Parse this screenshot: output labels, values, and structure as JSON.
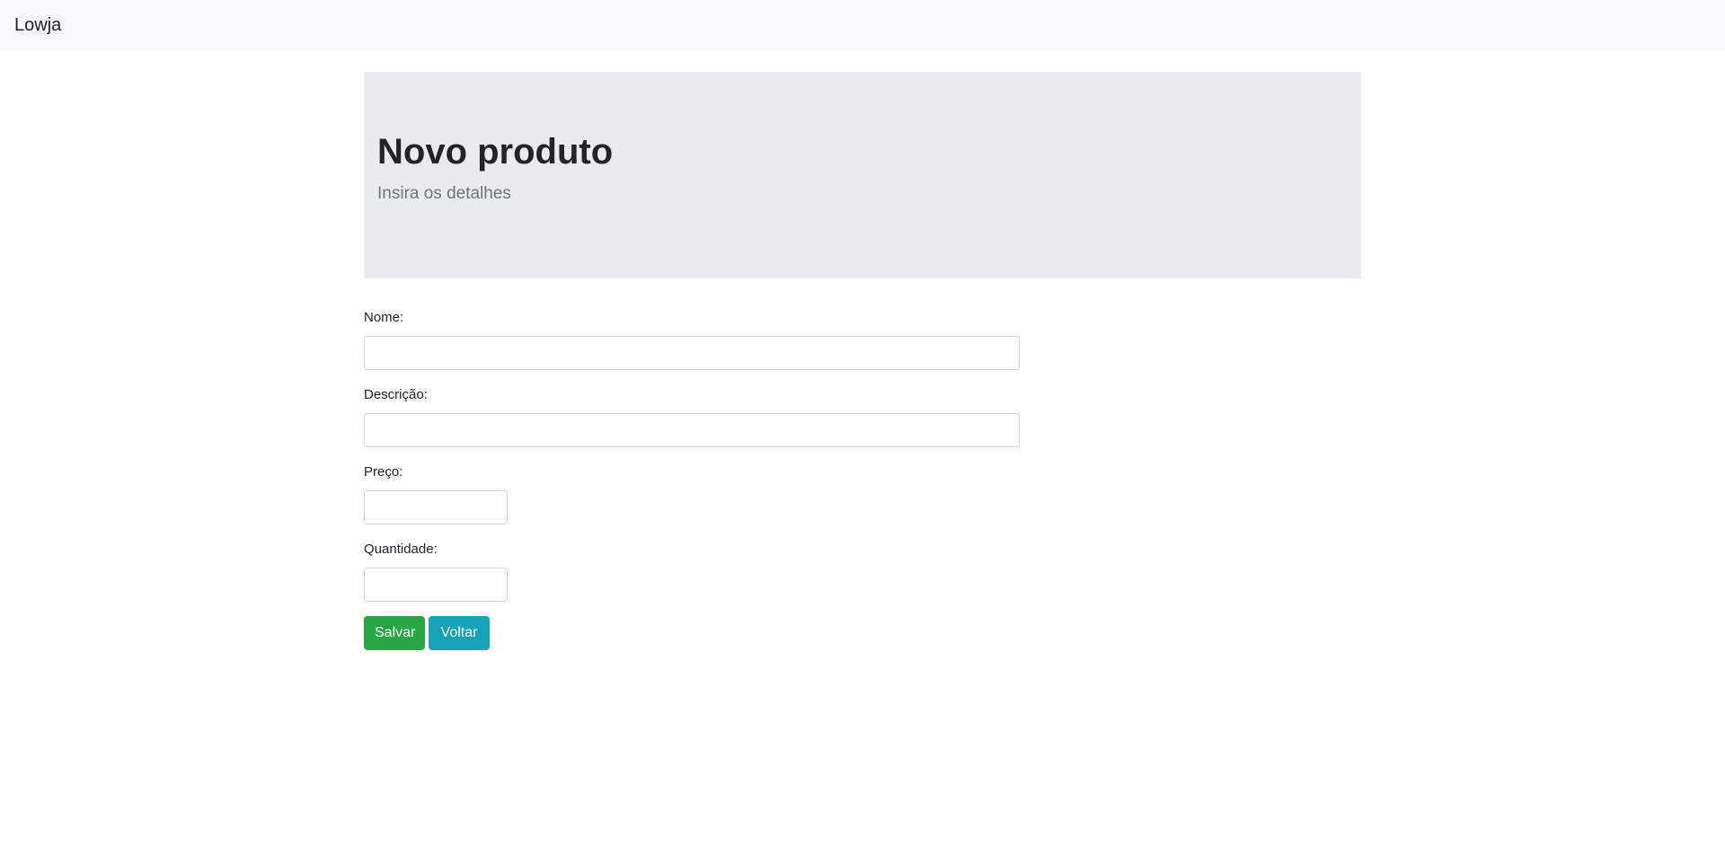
{
  "navbar": {
    "brand": "Lowja",
    "background": "#f8f9fa"
  },
  "jumbotron": {
    "title": "Novo produto",
    "lead": "Insira os detalhes",
    "background": "#e9ecef"
  },
  "form": {
    "fields": [
      {
        "label": "Nome:",
        "value": "",
        "placeholder": ""
      },
      {
        "label": "Descrição:",
        "value": "",
        "placeholder": ""
      },
      {
        "label": "Preço:",
        "value": "",
        "placeholder": ""
      },
      {
        "label": "Quantidade:",
        "value": "",
        "placeholder": ""
      }
    ],
    "save_label": "Salvar",
    "back_label": "Voltar",
    "save_color": "#28a745",
    "back_color": "#17a2b8"
  }
}
